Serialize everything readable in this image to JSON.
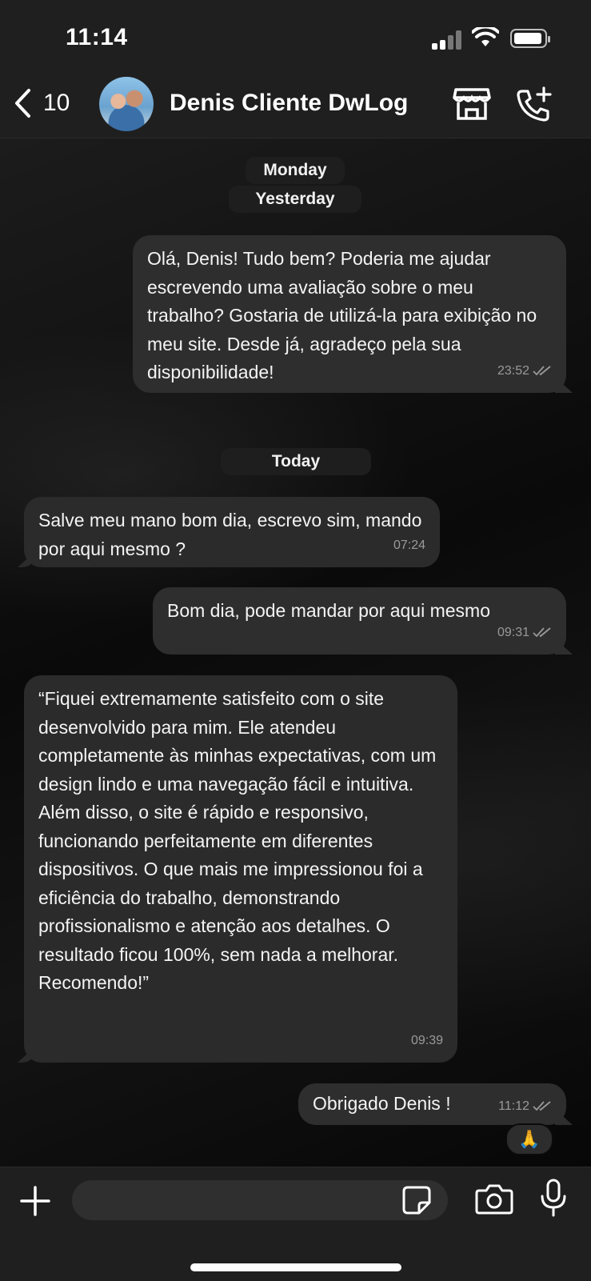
{
  "status_bar": {
    "time": "11:14"
  },
  "header": {
    "back_count": "10",
    "contact_name": "Denis Cliente DwLog"
  },
  "dates": {
    "monday": "Monday",
    "yesterday": "Yesterday",
    "today": "Today"
  },
  "messages": [
    {
      "direction": "outgoing",
      "text": "Olá, Denis! Tudo bem? Poderia me ajudar escrevendo uma avaliação sobre o meu trabalho? Gostaria de utilizá-la para exibição no meu site. Desde já, agradeço pela sua disponibilidade!",
      "time": "23:52",
      "status": "read"
    },
    {
      "direction": "incoming",
      "text": "Salve meu mano bom dia, escrevo sim, mando por aqui mesmo ?",
      "time": "07:24"
    },
    {
      "direction": "outgoing",
      "text": "Bom dia, pode mandar por aqui mesmo",
      "time": "09:31",
      "status": "read"
    },
    {
      "direction": "incoming",
      "text": "“Fiquei extremamente satisfeito com o site desenvolvido para mim. Ele atendeu completamente às minhas expectativas, com um design lindo e uma navegação fácil e intuitiva. Além disso, o site é rápido e responsivo, funcionando perfeitamente em diferentes dispositivos. O que mais me impressionou foi a eficiência do trabalho, demonstrando profissionalismo e atenção aos detalhes. O resultado ficou 100%, sem nada a melhorar. Recomendo!”",
      "time": "09:39"
    },
    {
      "direction": "outgoing",
      "text": "Obrigado Denis !",
      "time": "11:12",
      "status": "read",
      "reaction": "🙏"
    }
  ],
  "composer": {
    "placeholder": ""
  },
  "icons": [
    "chevron-left-icon",
    "store-icon",
    "phone-plus-icon",
    "plus-icon",
    "sticker-icon",
    "camera-icon",
    "microphone-icon",
    "double-check-icon"
  ],
  "colors": {
    "header_bg": "#1f1f1f",
    "bubble_bg": "#2b2b2b",
    "text": "#f4f4f4",
    "meta": "#9a9a9a"
  }
}
